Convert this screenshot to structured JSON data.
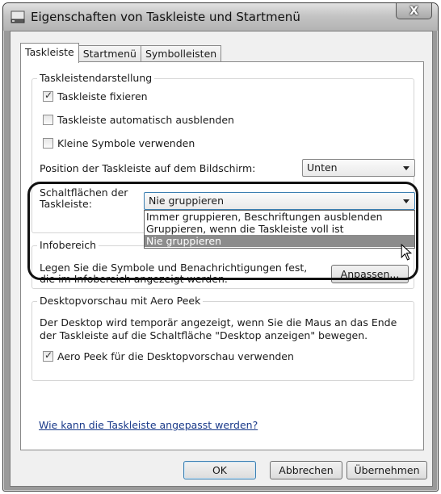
{
  "window": {
    "title": "Eigenschaften von Taskleiste und Startmenü",
    "close_label": "X"
  },
  "tabs": [
    {
      "label": "Taskleiste",
      "active": true
    },
    {
      "label": "Startmenü",
      "active": false
    },
    {
      "label": "Symbolleisten",
      "active": false
    }
  ],
  "taskbar_appearance": {
    "title": "Taskleistendarstellung",
    "lock_taskbar": {
      "label": "Taskleiste fixieren",
      "checked": true
    },
    "autohide": {
      "label": "Taskleiste automatisch ausblenden",
      "checked": false
    },
    "small_icons": {
      "label": "Kleine Symbole verwenden",
      "checked": false
    },
    "position_label": "Position der Taskleiste auf dem Bildschirm:",
    "position_value": "Unten",
    "buttons_label_line1": "Schaltflächen der",
    "buttons_label_line2": "Taskleiste:",
    "buttons_value": "Nie gruppieren",
    "buttons_options": [
      "Immer gruppieren, Beschriftungen ausblenden",
      "Gruppieren, wenn die Taskleiste voll ist",
      "Nie gruppieren"
    ],
    "buttons_selected_index": 2
  },
  "notification_area": {
    "title": "Infobereich",
    "text_line1": "Legen Sie die Symbole und Benachrichtigungen fest,",
    "text_line2": "die im Infobereich angezeigt werden.",
    "customize_button": "Anpassen..."
  },
  "aero_peek": {
    "title": "Desktopvorschau mit Aero Peek",
    "text_line1": "Der Desktop wird temporär angezeigt, wenn Sie die Maus an das Ende",
    "text_line2": "der Taskleiste auf die Schaltfläche \"Desktop anzeigen\" bewegen.",
    "use_peek": {
      "label": "Aero Peek für die Desktopvorschau verwenden",
      "checked": true
    }
  },
  "help_link": "Wie kann die Taskleiste angepasst werden?",
  "footer": {
    "ok": "OK",
    "cancel": "Abbrechen",
    "apply": "Übernehmen"
  }
}
